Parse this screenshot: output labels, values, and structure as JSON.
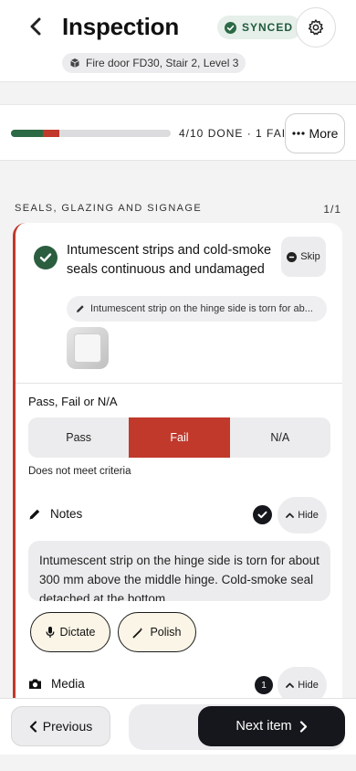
{
  "header": {
    "title": "Inspection",
    "sync_status": "SYNCED",
    "context": "Fire door FD30, Stair 2, Level 3"
  },
  "progress": {
    "done_fraction": 0.3,
    "fail_fraction": 0.1,
    "text": "4/10 DONE · 1 FAIL",
    "more_label": "More"
  },
  "section": {
    "label": "SEALS, GLAZING AND SIGNAGE",
    "count": "1/1"
  },
  "item": {
    "title": "Intumescent strips and cold-smoke seals continuous and undamaged",
    "skip_label": "Skip",
    "note_preview": "Intumescent strip on the hinge side is torn for ab...",
    "result_label": "Pass, Fail or N/A",
    "options": [
      "Pass",
      "Fail",
      "N/A"
    ],
    "selected": "Fail",
    "criteria_text": "Does not meet criteria",
    "notes_label": "Notes",
    "notes_hide": "Hide",
    "notes_text": "Intumescent strip on the hinge side is torn for about 300 mm above the middle hinge. Cold-smoke seal detached at the bottom",
    "dictate_label": "Dictate",
    "polish_label": "Polish",
    "media_label": "Media",
    "media_count": "1",
    "media_hide": "Hide"
  },
  "footer": {
    "previous_label": "Previous",
    "next_label": "Next item"
  },
  "colors": {
    "accent_green": "#2b6a45",
    "fail_red": "#c0392b",
    "dark": "#16171c"
  }
}
